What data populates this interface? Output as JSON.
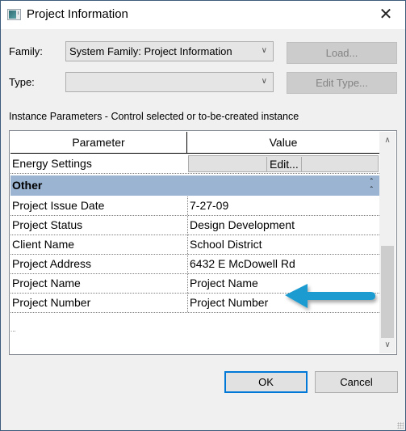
{
  "window": {
    "title": "Project Information",
    "close_glyph": "✕"
  },
  "family": {
    "label": "Family:",
    "value": "System Family: Project Information",
    "load_button": "Load..."
  },
  "type": {
    "label": "Type:",
    "value": "",
    "edit_type_button": "Edit Type..."
  },
  "section_label": "Instance Parameters - Control selected or to-be-created instance",
  "grid": {
    "headers": [
      "Parameter",
      "Value"
    ],
    "energy_settings": {
      "parameter": "Energy Settings",
      "button": "Edit..."
    },
    "group": {
      "label": "Other",
      "collapse_glyph": "⌃"
    },
    "rows": [
      {
        "parameter": "Project Issue Date",
        "value": "7-27-09"
      },
      {
        "parameter": "Project Status",
        "value": "Design Development"
      },
      {
        "parameter": "Client Name",
        "value": "School District"
      },
      {
        "parameter": "Project Address",
        "value": "6432 E McDowell Rd"
      },
      {
        "parameter": "Project Name",
        "value": "Project Name"
      },
      {
        "parameter": "Project Number",
        "value": "Project Number"
      }
    ],
    "ellipsis": "...",
    "scroll_up_glyph": "︿",
    "scroll_down_glyph": "﹀"
  },
  "annotation": {
    "arrow_color": "#1a9bd1",
    "points_to": "Project Name"
  },
  "footer": {
    "ok": "OK",
    "cancel": "Cancel"
  },
  "colors": {
    "group_header": "#9ab4d2",
    "default_button_border": "#0078d7"
  }
}
